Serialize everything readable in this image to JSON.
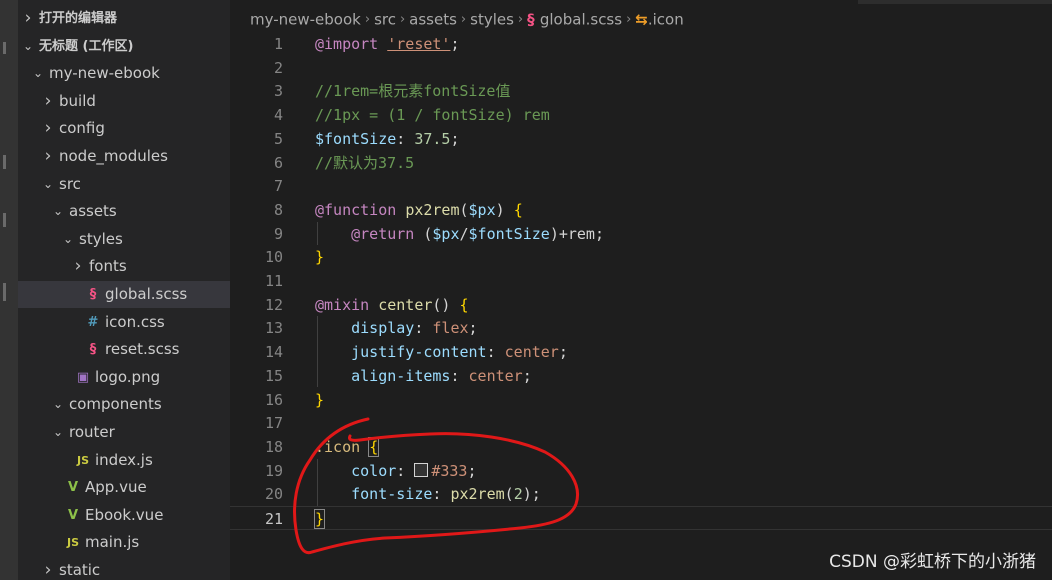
{
  "explorer": {
    "rows": [
      {
        "label": "打开的编辑器",
        "chev": "›",
        "icon": "",
        "icon_color": "",
        "bold": true
      },
      {
        "label": "无标题 (工作区)",
        "chev": "⌄",
        "icon": "",
        "icon_color": "",
        "bold": true
      },
      {
        "label": "my-new-ebook",
        "chev": "⌄",
        "icon": "",
        "icon_color": "",
        "bold": false
      },
      {
        "label": "build",
        "chev": "›",
        "icon": "",
        "icon_color": "",
        "bold": false
      },
      {
        "label": "config",
        "chev": "›",
        "icon": "",
        "icon_color": "",
        "bold": false
      },
      {
        "label": "node_modules",
        "chev": "›",
        "icon": "",
        "icon_color": "",
        "bold": false
      },
      {
        "label": "src",
        "chev": "⌄",
        "icon": "",
        "icon_color": "",
        "bold": false
      },
      {
        "label": "assets",
        "chev": "⌄",
        "icon": "",
        "icon_color": "",
        "bold": false
      },
      {
        "label": "styles",
        "chev": "⌄",
        "icon": "",
        "icon_color": "",
        "bold": false
      },
      {
        "label": "fonts",
        "chev": "›",
        "icon": "",
        "icon_color": "",
        "bold": false
      },
      {
        "label": "global.scss",
        "chev": "",
        "icon": "§",
        "icon_color": "#f55385",
        "bold": false,
        "selected": true
      },
      {
        "label": "icon.css",
        "chev": "",
        "icon": "#",
        "icon_color": "#519aba",
        "bold": false
      },
      {
        "label": "reset.scss",
        "chev": "",
        "icon": "§",
        "icon_color": "#f55385",
        "bold": false
      },
      {
        "label": "logo.png",
        "chev": "",
        "icon": "▣",
        "icon_color": "#a074c4",
        "bold": false
      },
      {
        "label": "components",
        "chev": "⌄",
        "icon": "",
        "icon_color": "",
        "bold": false
      },
      {
        "label": "router",
        "chev": "⌄",
        "icon": "",
        "icon_color": "",
        "bold": false
      },
      {
        "label": "index.js",
        "chev": "",
        "icon": "JS",
        "icon_color": "#cbcb41",
        "bold": false
      },
      {
        "label": "App.vue",
        "chev": "",
        "icon": "V",
        "icon_color": "#8dc149",
        "bold": false
      },
      {
        "label": "Ebook.vue",
        "chev": "",
        "icon": "V",
        "icon_color": "#8dc149",
        "bold": false
      },
      {
        "label": "main.js",
        "chev": "",
        "icon": "JS",
        "icon_color": "#cbcb41",
        "bold": false
      },
      {
        "label": "static",
        "chev": "›",
        "icon": "",
        "icon_color": "",
        "bold": false
      }
    ]
  },
  "breadcrumb": {
    "parts": [
      "my-new-ebook",
      "src",
      "assets",
      "styles",
      "global.scss",
      ".icon"
    ],
    "file_icon": "§",
    "symbol_icon": "⇆"
  },
  "code_lines": [
    {
      "n": "1",
      "tokens": [
        {
          "t": "@import",
          "c": "kw"
        },
        {
          "t": " "
        },
        {
          "t": "'reset'",
          "c": "str"
        },
        {
          "t": ";"
        }
      ]
    },
    {
      "n": "2",
      "tokens": []
    },
    {
      "n": "3",
      "tokens": [
        {
          "t": "//1rem=根元素fontSize值",
          "c": "cm"
        }
      ]
    },
    {
      "n": "4",
      "tokens": [
        {
          "t": "//1px = (1 / fontSize) rem",
          "c": "cm"
        }
      ]
    },
    {
      "n": "5",
      "tokens": [
        {
          "t": "$fontSize",
          "c": "var"
        },
        {
          "t": ": "
        },
        {
          "t": "37.5",
          "c": "num"
        },
        {
          "t": ";"
        }
      ]
    },
    {
      "n": "6",
      "tokens": [
        {
          "t": "//默认为37.5",
          "c": "cm"
        }
      ]
    },
    {
      "n": "7",
      "tokens": []
    },
    {
      "n": "8",
      "tokens": [
        {
          "t": "@function",
          "c": "kw"
        },
        {
          "t": " "
        },
        {
          "t": "px2rem",
          "c": "fn"
        },
        {
          "t": "("
        },
        {
          "t": "$px",
          "c": "var"
        },
        {
          "t": ") "
        },
        {
          "t": "{",
          "c": "br"
        }
      ]
    },
    {
      "n": "9",
      "tokens": [
        {
          "t": "    "
        },
        {
          "t": "@return",
          "c": "kw"
        },
        {
          "t": " ("
        },
        {
          "t": "$px",
          "c": "var"
        },
        {
          "t": "/"
        },
        {
          "t": "$fontSize",
          "c": "var"
        },
        {
          "t": ")+rem;"
        }
      ]
    },
    {
      "n": "10",
      "tokens": [
        {
          "t": "}",
          "c": "br"
        }
      ]
    },
    {
      "n": "11",
      "tokens": []
    },
    {
      "n": "12",
      "tokens": [
        {
          "t": "@mixin",
          "c": "kw"
        },
        {
          "t": " "
        },
        {
          "t": "center",
          "c": "fn"
        },
        {
          "t": "() "
        },
        {
          "t": "{",
          "c": "br"
        }
      ]
    },
    {
      "n": "13",
      "tokens": [
        {
          "t": "    "
        },
        {
          "t": "display",
          "c": "prop"
        },
        {
          "t": ": "
        },
        {
          "t": "flex",
          "c": "val"
        },
        {
          "t": ";"
        }
      ]
    },
    {
      "n": "14",
      "tokens": [
        {
          "t": "    "
        },
        {
          "t": "justify-content",
          "c": "prop"
        },
        {
          "t": ": "
        },
        {
          "t": "center",
          "c": "val"
        },
        {
          "t": ";"
        }
      ]
    },
    {
      "n": "15",
      "tokens": [
        {
          "t": "    "
        },
        {
          "t": "align-items",
          "c": "prop"
        },
        {
          "t": ": "
        },
        {
          "t": "center",
          "c": "val"
        },
        {
          "t": ";"
        }
      ]
    },
    {
      "n": "16",
      "tokens": [
        {
          "t": "}",
          "c": "br"
        }
      ]
    },
    {
      "n": "17",
      "tokens": []
    },
    {
      "n": "18",
      "tokens": [
        {
          "t": ".icon",
          "c": "sel-c"
        },
        {
          "t": " "
        },
        {
          "t": "{",
          "c": "br brbox"
        }
      ]
    },
    {
      "n": "19",
      "tokens": [
        {
          "t": "    "
        },
        {
          "t": "color",
          "c": "prop"
        },
        {
          "t": ": "
        },
        {
          "t": "",
          "c": "swatch"
        },
        {
          "t": "#333",
          "c": "val"
        },
        {
          "t": ";"
        }
      ]
    },
    {
      "n": "20",
      "tokens": [
        {
          "t": "    "
        },
        {
          "t": "font-size",
          "c": "prop"
        },
        {
          "t": ": "
        },
        {
          "t": "px2rem",
          "c": "fn"
        },
        {
          "t": "("
        },
        {
          "t": "2",
          "c": "num"
        },
        {
          "t": ");"
        }
      ]
    },
    {
      "n": "21",
      "tokens": [
        {
          "t": "}",
          "c": "br brbox"
        }
      ],
      "current": true
    }
  ],
  "watermark": "CSDN @彩虹桥下的小浙猪",
  "colors": {
    "annotation": "#e01818",
    "background": "#1e1e1e",
    "sidebar": "#252526"
  }
}
